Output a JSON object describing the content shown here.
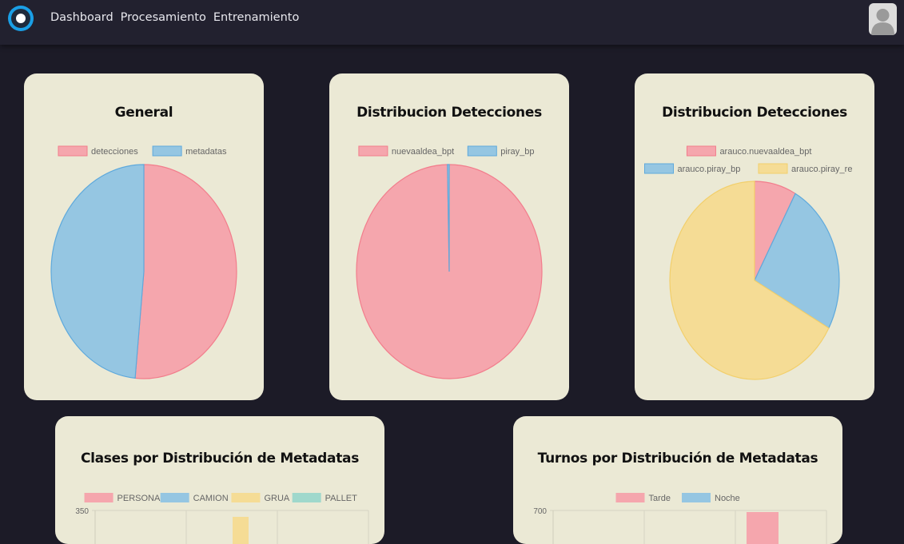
{
  "nav": {
    "items": [
      "Dashboard",
      "Procesamiento",
      "Entrenamiento"
    ]
  },
  "colors": {
    "red": "#f5a6ad",
    "red_border": "#f27d8c",
    "blue": "#95c6e2",
    "blue_border": "#5ea9dc",
    "yellow": "#f5dc95",
    "yellow_border": "#f2cf6b",
    "teal": "#9fd8cc",
    "card_bg": "#ebe9d5",
    "page_bg": "#1c1b27"
  },
  "icons": {
    "logo": "circle-logo-icon",
    "avatar": "user-avatar-icon"
  },
  "charts": {
    "general": {
      "title": "General"
    },
    "dist1": {
      "title": "Distribucion Detecciones"
    },
    "dist2": {
      "title": "Distribucion Detecciones"
    },
    "clases": {
      "title": "Clases por Distribución de Metadatas"
    },
    "turnos": {
      "title": "Turnos por Distribución de Metadatas"
    }
  },
  "chart_data": [
    {
      "type": "pie",
      "title": "General",
      "labels": [
        "detecciones",
        "metadatas"
      ],
      "values": [
        51.5,
        48.5
      ]
    },
    {
      "type": "pie",
      "title": "Distribucion Detecciones",
      "labels": [
        "nuevaaldea_bpt",
        "piray_bp"
      ],
      "values": [
        99.7,
        0.3
      ]
    },
    {
      "type": "pie",
      "title": "Distribucion Detecciones",
      "labels": [
        "arauco.nuevaaldea_bpt",
        "arauco.piray_bp",
        "arauco.piray_re"
      ],
      "values": [
        8,
        25,
        67
      ]
    },
    {
      "type": "bar",
      "title": "Clases por Distribución de Metadatas",
      "series": [
        {
          "name": "PERSONA",
          "values": []
        },
        {
          "name": "CAMION",
          "values": []
        },
        {
          "name": "GRUA",
          "values": []
        },
        {
          "name": "PALLET",
          "values": []
        }
      ],
      "y_ticks": [
        "350"
      ]
    },
    {
      "type": "bar",
      "title": "Turnos por Distribución de Metadatas",
      "series": [
        {
          "name": "Tarde",
          "values": []
        },
        {
          "name": "Noche",
          "values": []
        }
      ],
      "y_ticks": [
        "700"
      ]
    }
  ]
}
